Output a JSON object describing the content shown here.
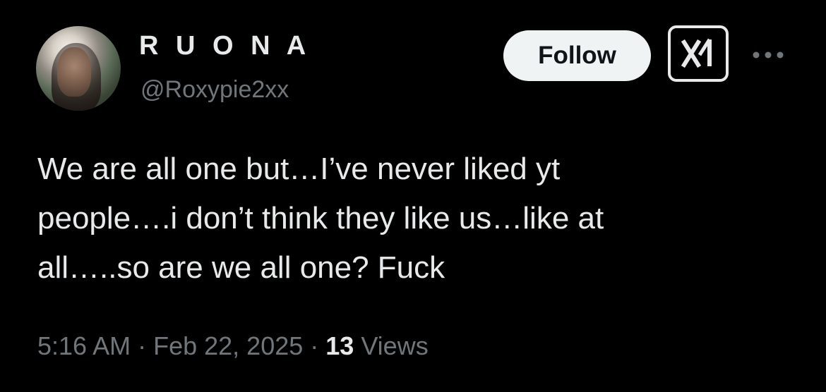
{
  "author": {
    "display_name": "R U O N A",
    "handle": "@Roxypie2xx",
    "avatar_icon": "profile-photo"
  },
  "actions": {
    "follow_label": "Follow",
    "grok_icon": "grok-icon",
    "more_icon": "more-horizontal-icon"
  },
  "tweet": {
    "lines": [
      "We are all one but…I’ve never liked yt",
      "people….i don’t think they like us…like at",
      "all…..so are we all one? Fuck"
    ]
  },
  "meta": {
    "time": "5:16 AM",
    "separator": " · ",
    "date": "Feb 22, 2025",
    "views_count": "13",
    "views_label": " Views"
  },
  "colors": {
    "background": "#000000",
    "primary_text": "#e7e9ea",
    "secondary_text": "#71767b",
    "follow_button_bg": "#eff3f4",
    "follow_button_text": "#0f1419"
  }
}
